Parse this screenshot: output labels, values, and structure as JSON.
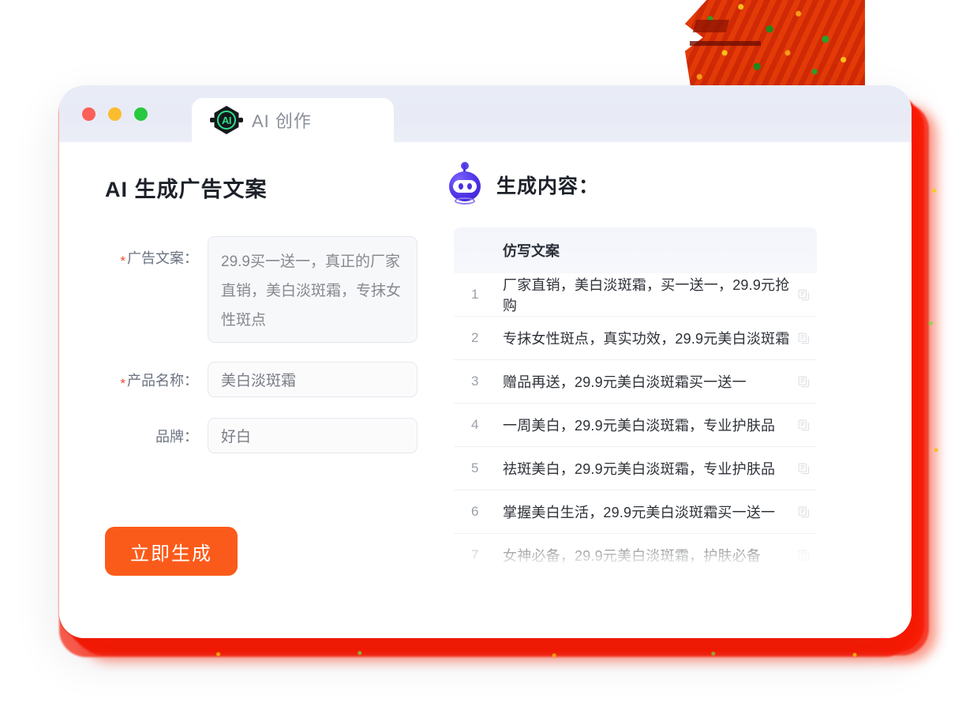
{
  "window": {
    "traffic_lights": [
      {
        "name": "close",
        "color": "#fb5f57"
      },
      {
        "name": "minimize",
        "color": "#fbbd2e"
      },
      {
        "name": "maximize",
        "color": "#28c840"
      }
    ],
    "tab": {
      "label": "AI 创作",
      "logo_text": "AI",
      "logo_icon": "ai-hexagon-icon"
    }
  },
  "left": {
    "title": "AI 生成广告文案",
    "fields": [
      {
        "label": "广告文案：",
        "required": true,
        "type": "textarea",
        "value": "29.9买一送一，真正的厂家直销，美白淡斑霜，专抹女性斑点"
      },
      {
        "label": "产品名称：",
        "required": true,
        "type": "input",
        "value": "美白淡斑霜"
      },
      {
        "label": "品牌：",
        "required": false,
        "type": "input",
        "value": "好白"
      }
    ],
    "submit_label": "立即生成",
    "submit_color": "#fb5b1a",
    "required_mark": "*",
    "required_color": "#f5462d"
  },
  "right": {
    "title": "生成内容：",
    "robot_icon": "robot-head-icon",
    "table": {
      "column_header": "仿写文案",
      "copy_icon": "copy-icon",
      "rows": [
        {
          "index": "1",
          "text": "厂家直销，美白淡斑霜，买一送一，29.9元抢购"
        },
        {
          "index": "2",
          "text": "专抹女性斑点，真实功效，29.9元美白淡斑霜"
        },
        {
          "index": "3",
          "text": "赠品再送，29.9元美白淡斑霜买一送一"
        },
        {
          "index": "4",
          "text": "一周美白，29.9元美白淡斑霜，专业护肤品"
        },
        {
          "index": "5",
          "text": "祛斑美白，29.9元美白淡斑霜，专业护肤品"
        },
        {
          "index": "6",
          "text": "掌握美白生活，29.9元美白淡斑霜买一送一"
        },
        {
          "index": "7",
          "text": "女神必备，29.9元美白淡斑霜，护肤必备"
        }
      ]
    }
  },
  "decoration": {
    "pattern_block": "red-orange-confetti-block",
    "glow_color": "#ff1a00"
  }
}
